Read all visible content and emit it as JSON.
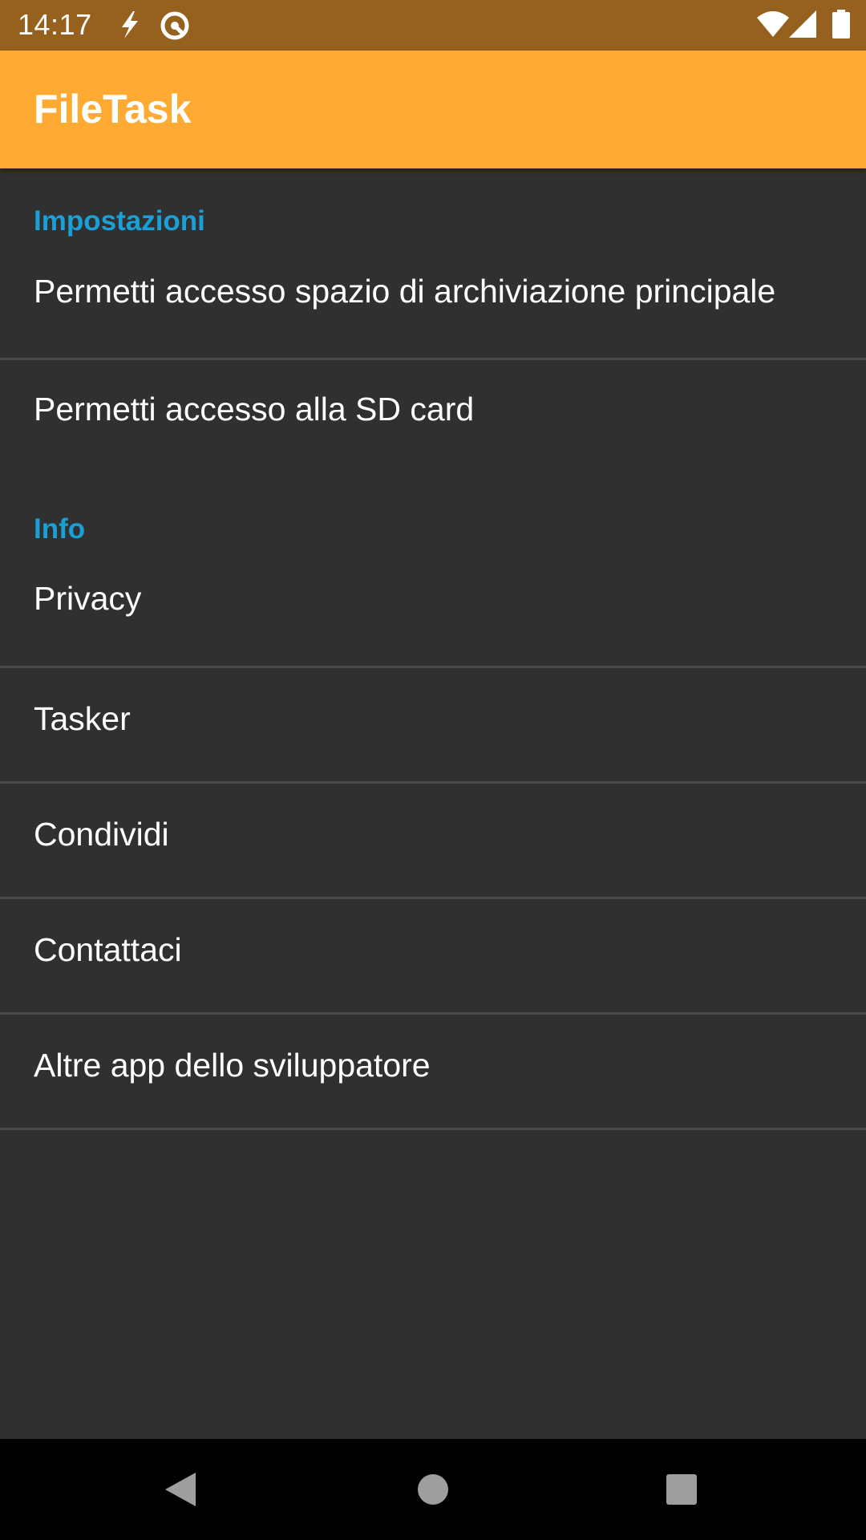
{
  "status_bar": {
    "time": "14:17",
    "icons": [
      "flash-icon",
      "vpn-icon",
      "wifi-icon",
      "signal-icon",
      "battery-icon"
    ],
    "color": "#96601e"
  },
  "app_bar": {
    "title": "FileTask",
    "color": "#ffaa33"
  },
  "accent_color": "#1a9fd6",
  "sections": {
    "settings": {
      "title": "Impostazioni",
      "items": [
        {
          "label": "Permetti accesso spazio di archiviazione principale"
        },
        {
          "label": "Permetti accesso alla SD card"
        }
      ]
    },
    "info": {
      "title": "Info",
      "items": [
        {
          "label": "Privacy"
        },
        {
          "label": "Tasker"
        },
        {
          "label": "Condividi"
        },
        {
          "label": "Contattaci"
        },
        {
          "label": "Altre app dello sviluppatore"
        }
      ]
    }
  },
  "nav_bar": {
    "icons": [
      "back-icon",
      "home-icon",
      "recents-icon"
    ]
  }
}
